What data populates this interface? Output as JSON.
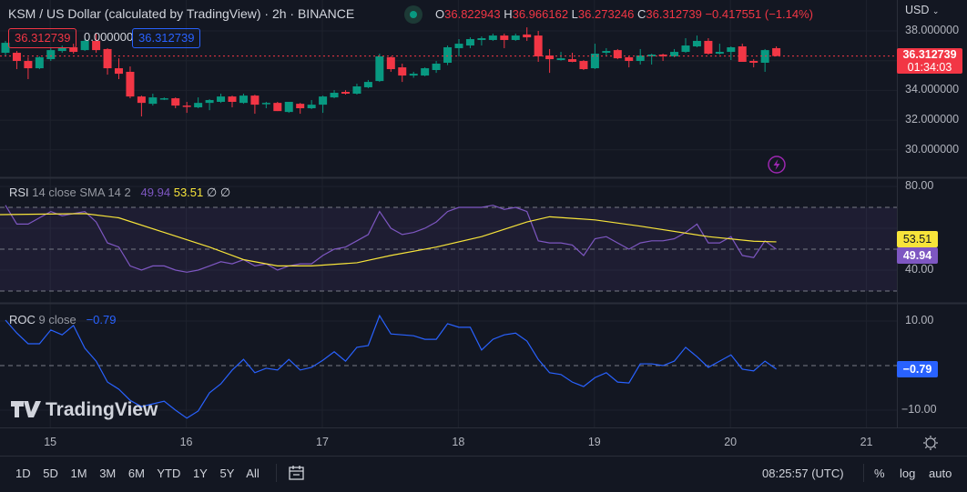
{
  "header": {
    "title": "KSM / US Dollar (calculated by TradingView) · 2h · BINANCE",
    "ohlc": {
      "o_label": "O",
      "o": "36.822943",
      "h_label": "H",
      "h": "36.966162",
      "l_label": "L",
      "l": "36.273246",
      "c_label": "C",
      "c": "36.312739",
      "change": "−0.417551 (−1.14%)"
    },
    "sell_price": "36.312739",
    "spread": "0.000000",
    "buy_price": "36.312739"
  },
  "price_axis": {
    "currency": "USD",
    "ticks": [
      "38.000000",
      "34.000000",
      "32.000000",
      "30.000000"
    ],
    "tick_values": [
      38,
      34,
      32,
      30
    ],
    "last_price": "36.312739",
    "countdown": "01:34:03"
  },
  "rsi": {
    "name": "RSI",
    "params": "14 close SMA 14 2",
    "value": "49.94",
    "sma_value": "53.51",
    "extra1": "∅",
    "extra2": "∅",
    "ticks": [
      "80.00",
      "40.00"
    ],
    "tick_values": [
      80,
      40
    ]
  },
  "roc": {
    "name": "ROC",
    "params": "9 close",
    "value": "−0.79",
    "ticks": [
      "10.00",
      "−10.00"
    ],
    "tick_values": [
      10,
      -10
    ]
  },
  "time_axis": {
    "labels": [
      "15",
      "16",
      "17",
      "18",
      "19",
      "20",
      "21"
    ],
    "first_label_index": 3.95,
    "bars_per_day": 12
  },
  "branding": {
    "logo_text": "TradingView"
  },
  "bottom_bar": {
    "ranges": [
      "1D",
      "5D",
      "1M",
      "3M",
      "6M",
      "YTD",
      "1Y",
      "5Y",
      "All"
    ],
    "clock": "08:25:57 (UTC)",
    "percent": "%",
    "log": "log",
    "auto": "auto"
  },
  "colors": {
    "up": "#089981",
    "down": "#f23645",
    "rsi": "#7e57c2",
    "sma": "#f7e43a",
    "roc": "#2962ff",
    "bg": "#131722"
  },
  "chart_data": {
    "type": "candlestick",
    "interval": "2h",
    "ohlc": [
      [
        36.53,
        37.33,
        36.29,
        37.2
      ],
      [
        36.53,
        36.65,
        35.43,
        35.98
      ],
      [
        35.98,
        36.23,
        34.76,
        35.49
      ],
      [
        35.49,
        36.29,
        35.43,
        36.23
      ],
      [
        36.1,
        36.84,
        35.98,
        36.71
      ],
      [
        36.65,
        37.02,
        36.53,
        36.9
      ],
      [
        36.9,
        37.14,
        36.47,
        36.59
      ],
      [
        36.71,
        37.45,
        36.65,
        37.33
      ],
      [
        37.33,
        37.82,
        36.53,
        36.71
      ],
      [
        36.78,
        36.84,
        35.06,
        35.49
      ],
      [
        35.49,
        36.16,
        34.76,
        35.12
      ],
      [
        35.25,
        35.61,
        33.47,
        33.59
      ],
      [
        33.59,
        33.65,
        32.25,
        33.16
      ],
      [
        33.1,
        33.78,
        32.98,
        33.53
      ],
      [
        33.41,
        33.53,
        33.35,
        33.47
      ],
      [
        33.47,
        33.53,
        32.8,
        32.98
      ],
      [
        32.98,
        33.23,
        32.49,
        32.92
      ],
      [
        32.86,
        33.53,
        32.8,
        33.16
      ],
      [
        33.16,
        33.41,
        32.67,
        33.35
      ],
      [
        33.23,
        33.78,
        33.16,
        33.59
      ],
      [
        33.59,
        33.65,
        32.86,
        33.23
      ],
      [
        33.16,
        33.78,
        33.1,
        33.65
      ],
      [
        33.65,
        33.71,
        32.43,
        33.04
      ],
      [
        33.1,
        33.23,
        32.8,
        33.16
      ],
      [
        33.16,
        33.23,
        32.61,
        32.61
      ],
      [
        32.55,
        33.23,
        32.49,
        33.23
      ],
      [
        33.1,
        33.16,
        32.43,
        32.8
      ],
      [
        32.8,
        33.35,
        32.74,
        33.04
      ],
      [
        33.04,
        33.65,
        32.49,
        33.59
      ],
      [
        33.53,
        34.02,
        33.47,
        33.84
      ],
      [
        33.9,
        34.02,
        33.72,
        33.78
      ],
      [
        33.78,
        34.45,
        33.72,
        34.27
      ],
      [
        34.21,
        34.7,
        34.15,
        34.57
      ],
      [
        34.63,
        36.47,
        34.57,
        36.29
      ],
      [
        36.23,
        36.29,
        35.25,
        35.43
      ],
      [
        35.55,
        35.8,
        34.57,
        35.0
      ],
      [
        35.0,
        35.25,
        34.85,
        35.12
      ],
      [
        35.0,
        35.55,
        34.95,
        35.49
      ],
      [
        35.37,
        35.98,
        35.18,
        35.8
      ],
      [
        35.86,
        37.02,
        35.7,
        36.9
      ],
      [
        36.84,
        37.45,
        36.29,
        37.14
      ],
      [
        37.02,
        37.57,
        36.84,
        37.45
      ],
      [
        37.39,
        37.63,
        37.02,
        37.51
      ],
      [
        37.39,
        37.82,
        37.33,
        37.69
      ],
      [
        37.69,
        37.82,
        36.84,
        37.39
      ],
      [
        37.39,
        37.82,
        37.33,
        37.69
      ],
      [
        37.76,
        38.24,
        37.33,
        37.57
      ],
      [
        37.69,
        38.0,
        35.92,
        36.29
      ],
      [
        36.35,
        36.78,
        35.18,
        36.1
      ],
      [
        36.04,
        36.59,
        36.0,
        36.16
      ],
      [
        36.1,
        36.53,
        35.9,
        35.92
      ],
      [
        35.98,
        36.04,
        35.37,
        35.43
      ],
      [
        35.49,
        37.14,
        35.43,
        36.47
      ],
      [
        36.53,
        36.84,
        36.35,
        36.65
      ],
      [
        36.71,
        36.78,
        36.1,
        36.16
      ],
      [
        36.23,
        36.29,
        35.55,
        35.98
      ],
      [
        35.98,
        36.78,
        35.74,
        36.35
      ],
      [
        36.29,
        36.47,
        35.74,
        36.41
      ],
      [
        36.41,
        36.47,
        35.98,
        36.29
      ],
      [
        36.29,
        36.78,
        36.23,
        36.59
      ],
      [
        36.59,
        37.51,
        36.53,
        37.02
      ],
      [
        36.96,
        37.69,
        36.9,
        37.33
      ],
      [
        37.33,
        37.51,
        36.41,
        36.47
      ],
      [
        36.47,
        37.14,
        36.41,
        36.59
      ],
      [
        36.59,
        36.96,
        36.04,
        36.9
      ],
      [
        36.96,
        37.14,
        35.92,
        35.92
      ],
      [
        35.98,
        36.1,
        35.55,
        35.86
      ],
      [
        35.86,
        36.78,
        35.25,
        36.71
      ],
      [
        36.84,
        36.96,
        36.29,
        36.31
      ]
    ],
    "price_range": [
      29.5,
      38.3
    ],
    "rsi_values": [
      71,
      62,
      62,
      65,
      68,
      66,
      67,
      68,
      63,
      53,
      51,
      42,
      40,
      42,
      42,
      40,
      39,
      40,
      42,
      44,
      43,
      45,
      42,
      43,
      40,
      42,
      43,
      43,
      47,
      50,
      51,
      54,
      57,
      68,
      60,
      57,
      58,
      60,
      63,
      68,
      70,
      70,
      70,
      71,
      69,
      70,
      68,
      54,
      53,
      53,
      52,
      47,
      55,
      56,
      53,
      50,
      53,
      54,
      54,
      55,
      58,
      62,
      53,
      53,
      56,
      47,
      46,
      54,
      49.94
    ],
    "rsi_sma": [
      [
        -1,
        66.5
      ],
      [
        7,
        67
      ],
      [
        10,
        65
      ],
      [
        14,
        58
      ],
      [
        18,
        51
      ],
      [
        21,
        45
      ],
      [
        24,
        42
      ],
      [
        27,
        42
      ],
      [
        31,
        43.5
      ],
      [
        34,
        47
      ],
      [
        38,
        51
      ],
      [
        42,
        56
      ],
      [
        46,
        63
      ],
      [
        48,
        65.5
      ],
      [
        52,
        64
      ],
      [
        56,
        61
      ],
      [
        62,
        56
      ],
      [
        66,
        53.8
      ],
      [
        68,
        53.51
      ]
    ],
    "rsi_range": [
      25,
      82
    ],
    "rsi_bands": [
      30,
      50,
      70
    ],
    "roc_values": [
      10.2,
      7.3,
      4.9,
      4.9,
      8,
      6.9,
      9,
      3.9,
      1,
      -3.7,
      -5.3,
      -7.8,
      -9.2,
      -8.6,
      -8,
      -10,
      -11.8,
      -10.2,
      -6.1,
      -4.1,
      -1,
      1.4,
      -1.6,
      -0.6,
      -1,
      1.4,
      -1,
      -0.4,
      1.2,
      3.1,
      1,
      4.1,
      4.5,
      11.2,
      7.1,
      6.9,
      6.7,
      5.9,
      5.9,
      9.4,
      8.6,
      8.6,
      3.5,
      5.9,
      6.9,
      7.3,
      5.5,
      1.4,
      -1.6,
      -2,
      -3.7,
      -4.7,
      -2.7,
      -1.6,
      -3.7,
      -3.9,
      0.4,
      0.4,
      0,
      1,
      4.1,
      2,
      -0.4,
      1,
      2.4,
      -0.8,
      -1.2,
      1,
      -0.79
    ]
  }
}
